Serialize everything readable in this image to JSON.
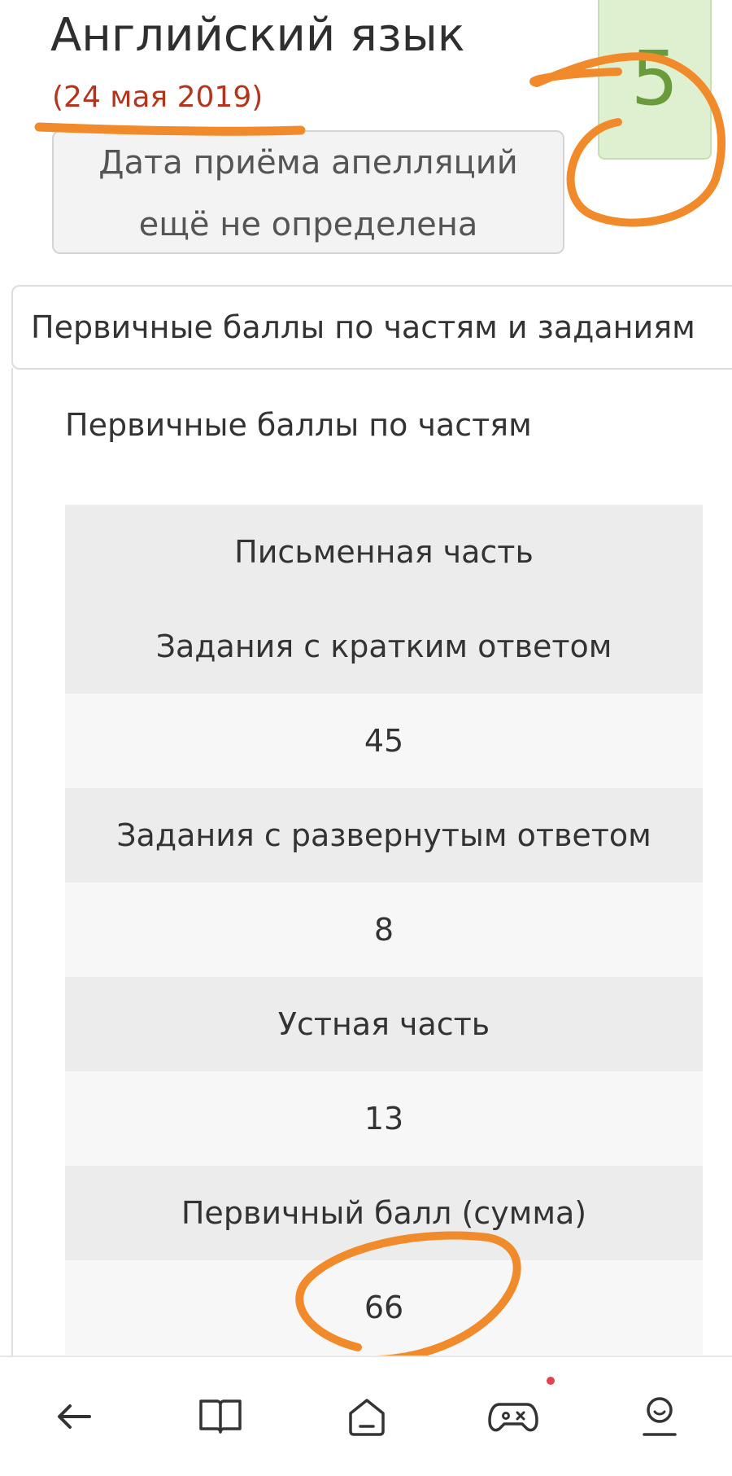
{
  "exam": {
    "subject": "Английский язык",
    "date": "(24 мая 2019)",
    "appeal_line1": "Дата приёма апелляций",
    "appeal_line2": "ещё не определена",
    "grade": "5"
  },
  "scores": {
    "section_title": "Первичные баллы по частям и заданиям",
    "subheading": "Первичные баллы по частям",
    "rows": [
      {
        "kind": "head",
        "text": "Письменная часть"
      },
      {
        "kind": "head",
        "text": "Задания с кратким ответом"
      },
      {
        "kind": "val",
        "text": "45"
      },
      {
        "kind": "head",
        "text": "Задания с развернутым ответом"
      },
      {
        "kind": "val",
        "text": "8"
      },
      {
        "kind": "head",
        "text": "Устная часть"
      },
      {
        "kind": "val",
        "text": "13"
      },
      {
        "kind": "head",
        "text": "Первичный балл (сумма)"
      },
      {
        "kind": "val",
        "text": "66"
      }
    ]
  },
  "nav": {
    "items": [
      {
        "name": "back-arrow-icon"
      },
      {
        "name": "book-icon"
      },
      {
        "name": "home-icon"
      },
      {
        "name": "gamepad-icon"
      },
      {
        "name": "profile-icon"
      }
    ],
    "notification_color": "#e3434e"
  },
  "colors": {
    "grade_bg": "#dff0d0",
    "grade_text": "#6a9a3a",
    "date_text": "#b5341c",
    "annotation": "#f08a2a"
  }
}
